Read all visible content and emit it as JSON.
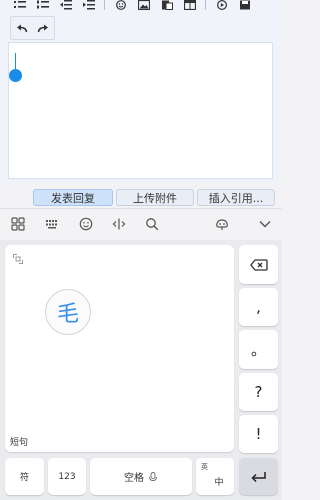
{
  "toolbar": {
    "icons": [
      "list-bullet-icon",
      "list-numbered-icon",
      "indent-decrease-icon",
      "indent-increase-icon",
      "emoji-icon",
      "image-icon",
      "paste-icon",
      "table-icon",
      "play-icon",
      "save-icon"
    ]
  },
  "editor": {
    "undo_icon": "undo-icon",
    "redo_icon": "redo-icon"
  },
  "actions": {
    "reply_label": "发表回复",
    "upload_label": "上传附件",
    "quote_label": "插入引用..."
  },
  "ime_bar": {
    "icons": [
      "grid-menu-icon",
      "keyboard-icon",
      "emoji-icon",
      "cursor-move-icon",
      "search-icon",
      "skin-icon",
      "collapse-chevron-icon"
    ]
  },
  "handwriting": {
    "candidate": "毛",
    "mode_label": "短句"
  },
  "keys": {
    "comma": ",",
    "period": "。",
    "question": "?",
    "exclaim": "!",
    "symbols_label": "符",
    "numbers_label": "123",
    "space_label": "空格",
    "lang_top": "英",
    "lang_bottom": "中"
  },
  "colors": {
    "accent": "#1a8be6",
    "candidate": "#3a8ef0"
  }
}
